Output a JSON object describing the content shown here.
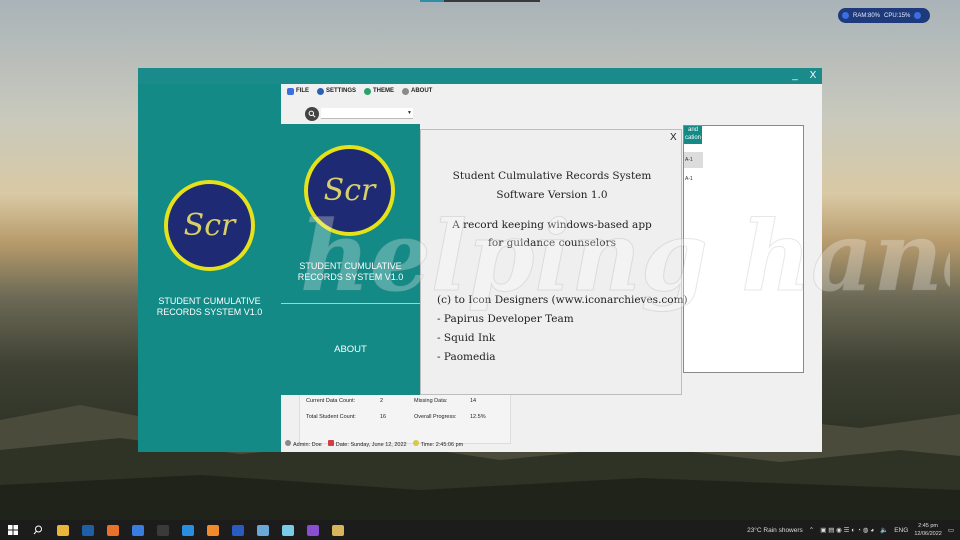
{
  "desktop": {
    "perf_widget": {
      "ram": "RAM:80%",
      "cpu": "CPU:15%"
    },
    "watermark_text": "helping hand"
  },
  "app": {
    "window_controls": {
      "minimize": "_",
      "close": "X"
    },
    "left_panel": {
      "logo_text": "Scr",
      "title_line1": "STUDENT CUMULATIVE",
      "title_line2": "RECORDS SYSTEM V1.0"
    },
    "menu": [
      {
        "label": "FILE",
        "icon": "file-icon",
        "color": "#3b6ee0"
      },
      {
        "label": "SETTINGS",
        "icon": "gear-icon",
        "color": "#2b5fb8"
      },
      {
        "label": "THEME",
        "icon": "palette-icon",
        "color": "#29a36a"
      },
      {
        "label": "ABOUT",
        "icon": "info-icon",
        "color": "#8a8a8a"
      }
    ],
    "search": {
      "placeholder": ""
    },
    "table": {
      "header": "and cation",
      "cells": [
        "A-1",
        "A-1"
      ]
    },
    "stats": {
      "current_label": "Current Data Count:",
      "current_value": "2",
      "missing_label": "Missing Data:",
      "missing_value": "14",
      "total_label": "Total Student Count:",
      "total_value": "16",
      "progress_label": "Overall Progress:",
      "progress_value": "12.5%"
    },
    "statusbar": {
      "admin_label": "Admin:",
      "admin_value": "Doe",
      "date_label": "Date:",
      "date_value": "Sunday, June 12, 2022",
      "time_label": "Time:",
      "time_value": "2:45:06 pm"
    }
  },
  "about_dialog": {
    "logo_text": "Scr",
    "title_line1": "STUDENT CUMULATIVE",
    "title_line2": "RECORDS SYSTEM V1.0",
    "nav_label": "ABOUT",
    "close_label": "X",
    "app_name": "Student Culmulative Records System",
    "version": "Software Version 1.0",
    "desc_line1": "A record keeping windows-based app",
    "desc_line2": "for guidance counselors",
    "credits": [
      "(c) to Icon Designers (www.iconarchieves.com)",
      "- Papirus Developer Team",
      "- Squid Ink",
      "- Paomedia"
    ]
  },
  "taskbar": {
    "apps": [
      {
        "name": "file-explorer-icon",
        "color": "#e8b73a"
      },
      {
        "name": "photoshop-icon",
        "color": "#1f5fa8"
      },
      {
        "name": "firefox-icon",
        "color": "#e8722a"
      },
      {
        "name": "thunderbird-icon",
        "color": "#3a7de0"
      },
      {
        "name": "terminal-icon",
        "color": "#3a3a3a"
      },
      {
        "name": "vscode-icon",
        "color": "#2a8ee0"
      },
      {
        "name": "xampp-icon",
        "color": "#f08a2a"
      },
      {
        "name": "word-icon",
        "color": "#2a5cc0"
      },
      {
        "name": "chrome-icon",
        "color": "#6aa8d8"
      },
      {
        "name": "notes-icon",
        "color": "#7acbe6"
      },
      {
        "name": "visual-studio-icon",
        "color": "#8a4ed0"
      },
      {
        "name": "scr-app-icon",
        "color": "#d8b45a"
      }
    ],
    "weather": "23°C  Rain showers",
    "lang": "ENG",
    "time": "2:45 pm",
    "date": "12/06/2022"
  }
}
